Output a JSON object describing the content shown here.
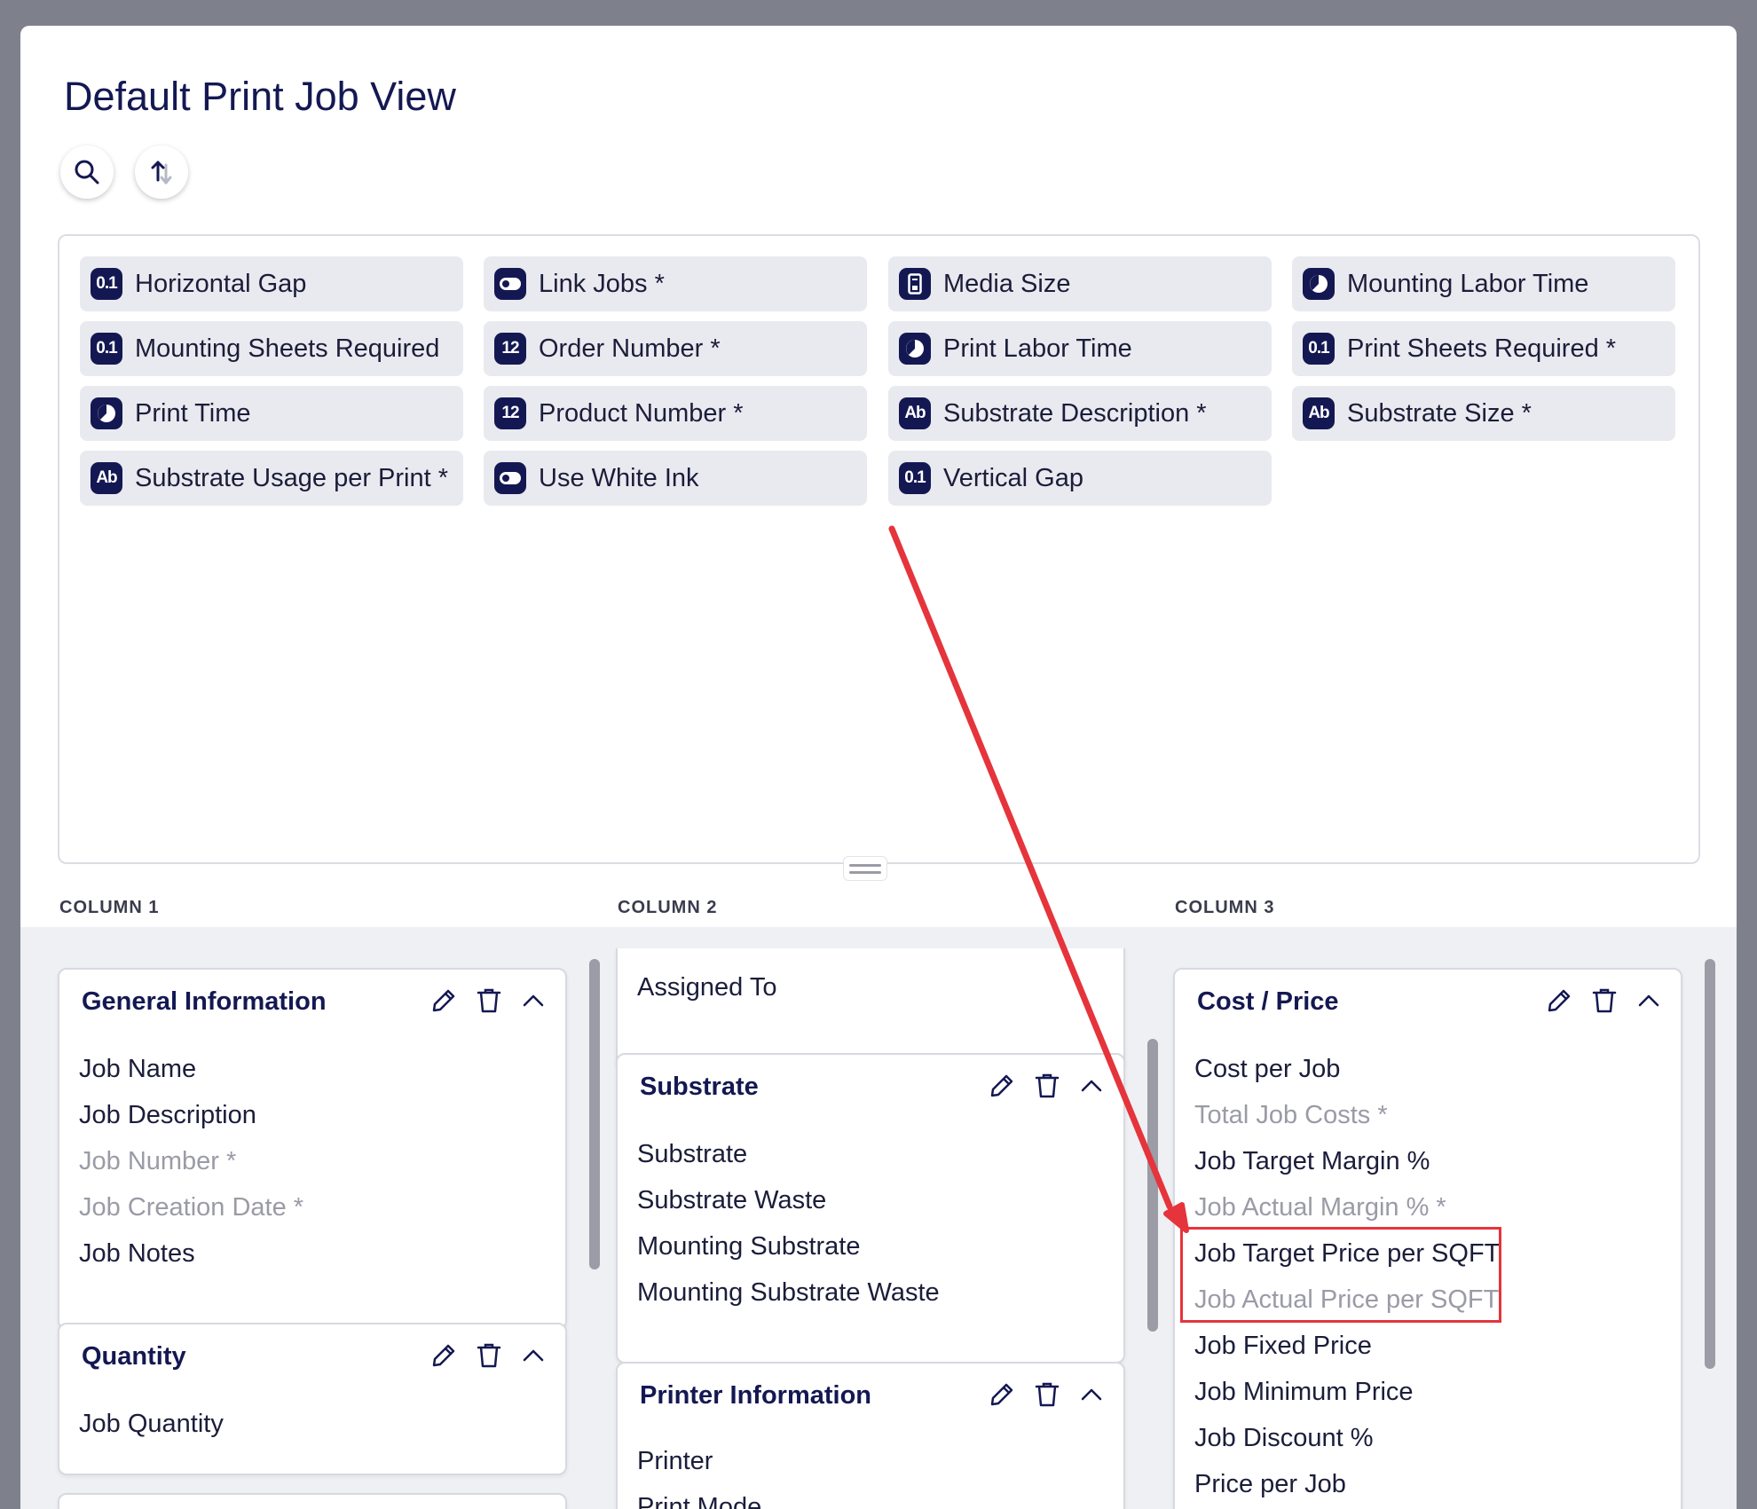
{
  "page_title": "Default Print Job View",
  "fields": [
    {
      "icon": "0.1",
      "label": "Horizontal Gap"
    },
    {
      "icon": "toggle",
      "label": "Link Jobs *"
    },
    {
      "icon": "media",
      "label": "Media Size"
    },
    {
      "icon": "clock",
      "label": "Mounting Labor Time"
    },
    {
      "icon": "0.1",
      "label": "Mounting Sheets Required"
    },
    {
      "icon": "12",
      "label": "Order Number *"
    },
    {
      "icon": "clock",
      "label": "Print Labor Time"
    },
    {
      "icon": "0.1",
      "label": "Print Sheets Required *"
    },
    {
      "icon": "clock",
      "label": "Print Time"
    },
    {
      "icon": "12",
      "label": "Product Number *"
    },
    {
      "icon": "Ab",
      "label": "Substrate Description *"
    },
    {
      "icon": "Ab",
      "label": "Substrate Size *"
    },
    {
      "icon": "Ab",
      "label": "Substrate Usage per Print *"
    },
    {
      "icon": "toggle",
      "label": "Use White Ink"
    },
    {
      "icon": "0.1",
      "label": "Vertical Gap"
    }
  ],
  "columns": {
    "col1": "COLUMN 1",
    "col2": "COLUMN 2",
    "col3": "COLUMN 3"
  },
  "cards": {
    "general": {
      "title": "General Information",
      "items": [
        "Job Name",
        "Job Description",
        "Job Number *",
        "Job Creation Date *",
        "Job Notes"
      ]
    },
    "quantity": {
      "title": "Quantity",
      "items": [
        "Job Quantity"
      ]
    },
    "assigned": {
      "items": [
        "Assigned To"
      ]
    },
    "substrate": {
      "title": "Substrate",
      "items": [
        "Substrate",
        "Substrate Waste",
        "Mounting Substrate",
        "Mounting Substrate Waste"
      ]
    },
    "printer": {
      "title": "Printer Information",
      "items": [
        "Printer",
        "Print Mode"
      ]
    },
    "cost": {
      "title": "Cost / Price",
      "items": [
        "Cost per Job",
        "Total Job Costs *",
        "Job Target Margin %",
        "Job Actual Margin % *",
        "Job Target Price per SQFT",
        "Job Actual Price per SQFT",
        "Job Fixed Price",
        "Job Minimum Price",
        "Job Discount %",
        "Price per Job"
      ]
    }
  },
  "colors": {
    "accent": "#141852",
    "annotation": "#e5343b",
    "muted_text": "#9a9ba6"
  }
}
